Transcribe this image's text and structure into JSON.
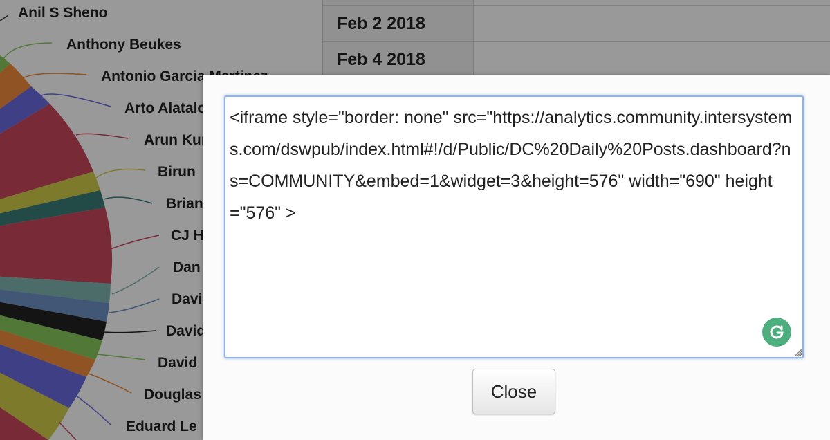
{
  "legend_names": [
    "Anil S Sheno",
    "Anthony Beukes",
    "Antonio Garcia Martinez",
    "Arto Alatalo",
    "Arun Kumar",
    "Birun",
    "Brian",
    "CJ H",
    "Dan",
    "Davi",
    "David",
    "David",
    "Douglas",
    "Eduard Le"
  ],
  "table": {
    "rows": [
      {
        "date": "Feb 2 2018",
        "value": ""
      },
      {
        "date": "Feb 4 2018",
        "value": ""
      }
    ]
  },
  "dialog": {
    "embed_code": "<iframe style=\"border: none\" src=\"https://analytics.community.intersystems.com/dswpub/index.html#!/d/Public/DC%20Daily%20Posts.dashboard?ns=COMMUNITY&embed=1&widget=3&height=576\" width=\"690\" height=\"576\" >",
    "close_label": "Close"
  },
  "colors": {
    "slice_green": "#88c85a",
    "slice_orange": "#f08a3b",
    "slice_blue": "#6a6ae0",
    "slice_red": "#c9465c",
    "slice_olive": "#d3cc4a",
    "slice_teal": "#3a7d79",
    "grammarly": "#4caf7d",
    "focus_border": "#8fb2e8"
  }
}
